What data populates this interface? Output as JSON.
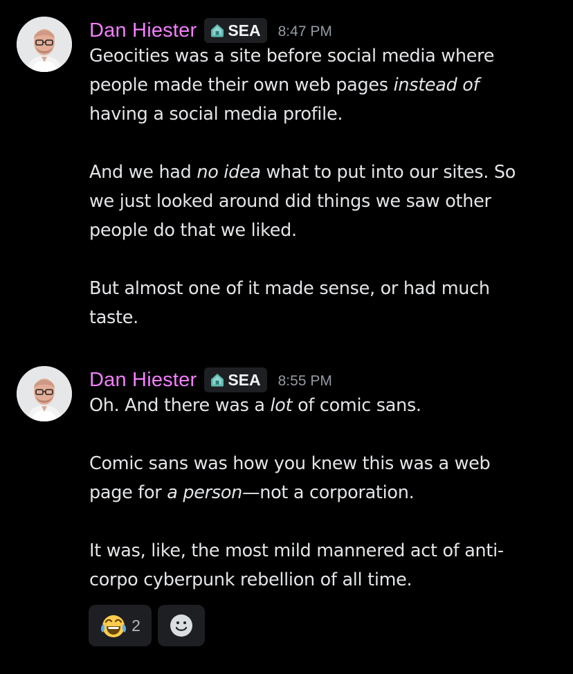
{
  "messages": [
    {
      "author": "Dan Hiester",
      "tag": "SEA",
      "time": "8:47 PM",
      "lines": [
        [
          "Geocities was a site before social media where"
        ],
        [
          "people made their own web pages ",
          "instead of"
        ],
        [
          "having a social media profile."
        ],
        [
          "And we had ",
          "no idea",
          " what to put into our sites. So"
        ],
        [
          "we just looked around did things we saw other"
        ],
        [
          "people do that we liked."
        ],
        [
          "But almost one of it made sense, or had much"
        ],
        [
          "taste."
        ]
      ]
    },
    {
      "author": "Dan Hiester",
      "tag": "SEA",
      "time": "8:55 PM",
      "lines": [
        [
          "Oh. And there was a ",
          "lot",
          " of comic sans."
        ],
        [
          "Comic sans was how you knew this was a web"
        ],
        [
          "page for ",
          "a person",
          "—not a corporation."
        ],
        [
          "It was, like, the most mild mannered act of anti-"
        ],
        [
          "corpo cyberpunk rebellion of all time."
        ]
      ]
    }
  ],
  "reactions": {
    "laugh": {
      "emoji": "joy-emoji",
      "count": "2"
    },
    "add": {
      "icon": "add-reaction-icon"
    }
  },
  "colors": {
    "background": "#000000",
    "username": "#f47fff",
    "text": "#e3e5e8",
    "timestamp": "#949ba4",
    "tag_bg": "#1e1f22"
  }
}
